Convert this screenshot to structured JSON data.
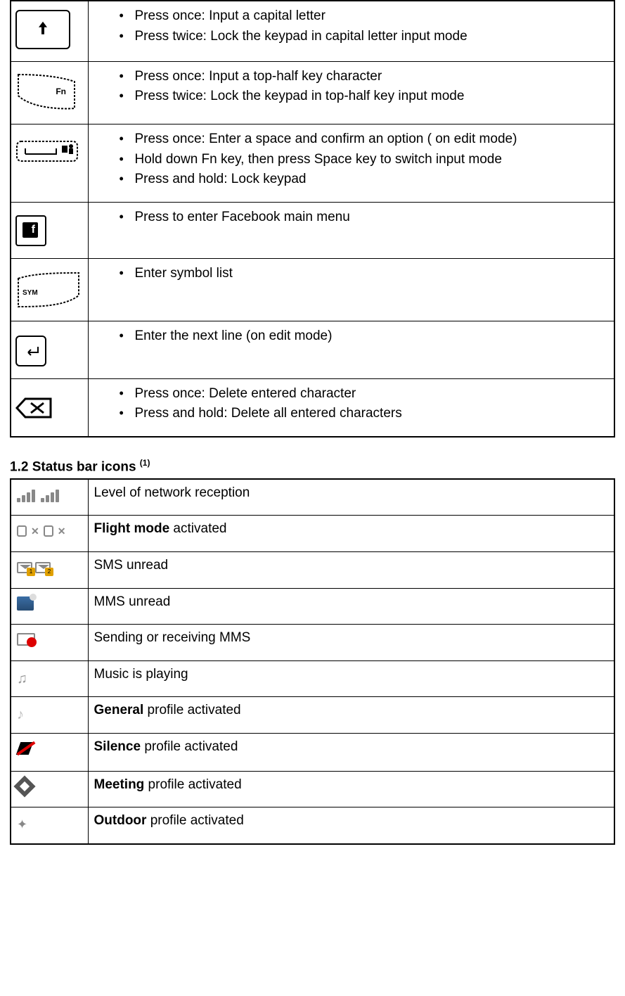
{
  "keys_table": {
    "rows": [
      {
        "icon": "shift-key-icon",
        "items": [
          "Press once: Input a capital letter",
          "Press twice: Lock the keypad in capital letter input mode"
        ]
      },
      {
        "icon": "fn-key-icon",
        "fn_label": "Fn",
        "items": [
          "Press once: Input a top-half key character",
          "Press twice: Lock the keypad in top-half key input mode"
        ]
      },
      {
        "icon": "space-key-icon",
        "items": [
          "Press once: Enter a space and confirm an option ( on edit mode)",
          "Hold down Fn key, then press Space key to switch input mode",
          "Press and hold: Lock keypad"
        ]
      },
      {
        "icon": "facebook-key-icon",
        "fb_label": "f",
        "items": [
          "Press to enter Facebook main menu"
        ]
      },
      {
        "icon": "sym-key-icon",
        "sym_label": "SYM",
        "items": [
          "Enter symbol list"
        ]
      },
      {
        "icon": "enter-key-icon",
        "items": [
          "Enter the next line (on edit mode)"
        ]
      },
      {
        "icon": "delete-key-icon",
        "items": [
          "Press once: Delete entered character",
          "Press and hold: Delete all entered characters"
        ]
      }
    ]
  },
  "section_heading": {
    "number_title": "1.2 Status bar icons",
    "footnote": "(1)"
  },
  "status_table": {
    "rows": [
      {
        "icon": "signal-icon",
        "text_plain": "Level of network reception"
      },
      {
        "icon": "flight-mode-icon",
        "bold": "Flight mode",
        "rest": " activated"
      },
      {
        "icon": "sms-unread-icon",
        "text_plain": "SMS unread"
      },
      {
        "icon": "mms-unread-icon",
        "text_plain": "MMS unread"
      },
      {
        "icon": "mms-transfer-icon",
        "text_plain": "Sending or receiving MMS"
      },
      {
        "icon": "music-playing-icon",
        "text_plain": "Music is playing"
      },
      {
        "icon": "general-profile-icon",
        "bold": "General",
        "rest": " profile activated"
      },
      {
        "icon": "silence-profile-icon",
        "bold": "Silence",
        "rest": " profile activated"
      },
      {
        "icon": "meeting-profile-icon",
        "bold": "Meeting",
        "rest": " profile activated"
      },
      {
        "icon": "outdoor-profile-icon",
        "bold": "Outdoor",
        "rest": " profile activated"
      }
    ]
  }
}
